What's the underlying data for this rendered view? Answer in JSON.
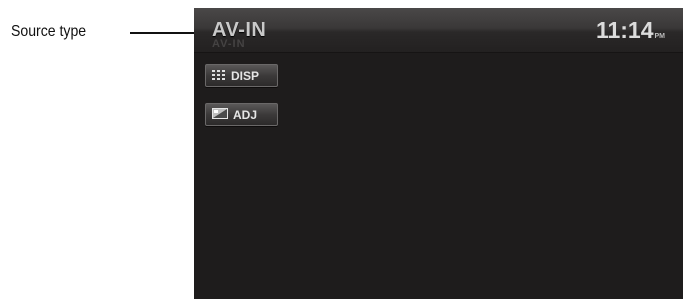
{
  "annotation": {
    "label": "Source type"
  },
  "screen": {
    "source": "AV-IN",
    "clock": {
      "time": "11:14",
      "suffix": "PM"
    },
    "softkeys": [
      {
        "label": "DISP",
        "icon": "disp-grid-icon"
      },
      {
        "label": "ADJ",
        "icon": "adjust-picture-icon"
      }
    ]
  },
  "colors": {
    "screen_bg": "#1e1c1c",
    "top_bar": "#3a3838",
    "text": "#c9c9c9"
  }
}
